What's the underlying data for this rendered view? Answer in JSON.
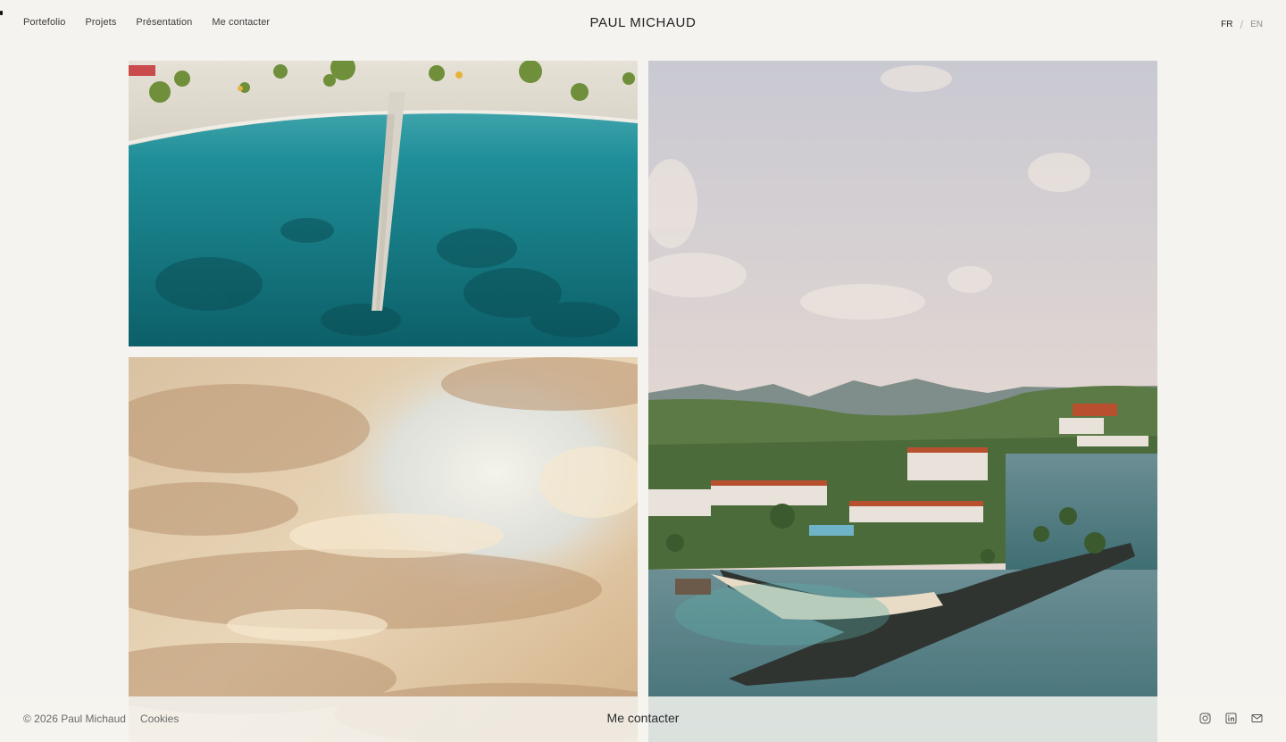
{
  "header": {
    "nav": [
      {
        "label": "Portefolio"
      },
      {
        "label": "Projets"
      },
      {
        "label": "Présentation"
      },
      {
        "label": "Me contacter"
      }
    ],
    "brand": "PAUL MICHAUD",
    "lang": {
      "active": "FR",
      "separator": "/",
      "inactive": "EN"
    }
  },
  "gallery": {
    "photos": [
      {
        "name": "aerial-beach-pier",
        "icon": "beach-photo"
      },
      {
        "name": "golden-clouds",
        "icon": "clouds-photo"
      },
      {
        "name": "coastal-resort",
        "icon": "resort-photo"
      }
    ]
  },
  "footer": {
    "copyright": "© 2026 Paul Michaud",
    "cookies": "Cookies",
    "contact": "Me contacter",
    "socials": [
      {
        "icon": "instagram-icon"
      },
      {
        "icon": "linkedin-icon"
      },
      {
        "icon": "mail-icon"
      }
    ]
  },
  "colors": {
    "background": "#f4f3ef",
    "text": "#2b2b2b",
    "muted": "#6a6a6a"
  }
}
